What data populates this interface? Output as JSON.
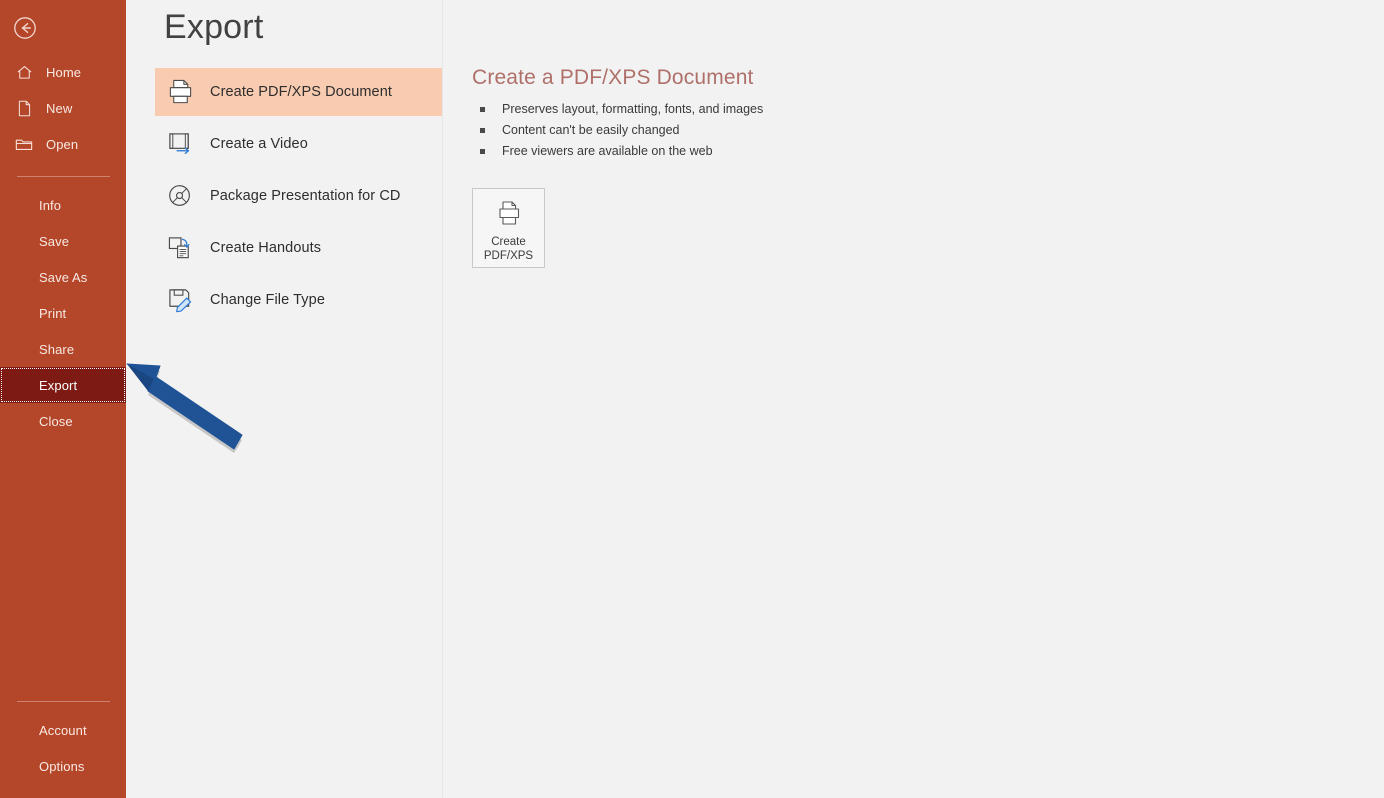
{
  "app": {
    "page_title": "Export",
    "accent_sidebar": "#b4462a",
    "accent_selected": "#7d1a14",
    "accent_highlight": "#f9cbb0",
    "heading_color": "#b0706a",
    "annotation_color": "#1f5396"
  },
  "sidebar": {
    "back_label": "Back",
    "icon_items": [
      {
        "label": "Home",
        "icon": "home-icon"
      },
      {
        "label": "New",
        "icon": "new-document-icon"
      },
      {
        "label": "Open",
        "icon": "open-folder-icon"
      }
    ],
    "text_items": [
      {
        "label": "Info",
        "selected": false
      },
      {
        "label": "Save",
        "selected": false
      },
      {
        "label": "Save As",
        "selected": false
      },
      {
        "label": "Print",
        "selected": false
      },
      {
        "label": "Share",
        "selected": false
      },
      {
        "label": "Export",
        "selected": true
      },
      {
        "label": "Close",
        "selected": false
      }
    ],
    "bottom_items": [
      {
        "label": "Account"
      },
      {
        "label": "Options"
      }
    ]
  },
  "export_options": [
    {
      "label": "Create PDF/XPS Document",
      "icon": "pdf-document-icon",
      "active": true
    },
    {
      "label": "Create a Video",
      "icon": "video-film-icon",
      "active": false
    },
    {
      "label": "Package Presentation for CD",
      "icon": "cd-disc-icon",
      "active": false
    },
    {
      "label": "Create Handouts",
      "icon": "handouts-icon",
      "active": false
    },
    {
      "label": "Change File Type",
      "icon": "file-type-icon",
      "active": false
    }
  ],
  "detail": {
    "heading": "Create a PDF/XPS Document",
    "bullets": [
      "Preserves layout, formatting, fonts, and images",
      "Content can't be easily changed",
      "Free viewers are available on the web"
    ],
    "button": {
      "line1": "Create",
      "line2": "PDF/XPS",
      "icon": "pdf-printer-icon"
    }
  },
  "annotation": {
    "type": "arrow",
    "points_to": "Export",
    "color": "#1f5396"
  }
}
